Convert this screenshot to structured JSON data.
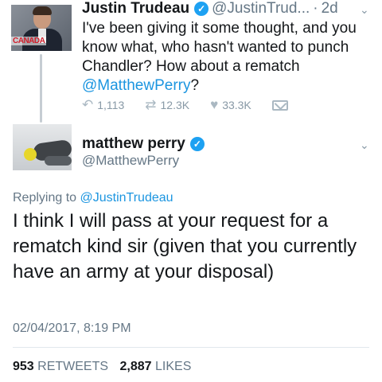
{
  "tweet1": {
    "avatar_text": "CANADA",
    "name": "Justin Trudeau",
    "handle": "@JustinTrud...",
    "separator": "·",
    "date": "2d",
    "body_text": "I've been giving it some thought, and you know what, who hasn't wanted to punch Chandler? How about a rematch ",
    "body_mention": "@MatthewPerry",
    "body_end": "?",
    "replies": "1,113",
    "retweets": "12.3K",
    "likes": "33.3K"
  },
  "tweet2": {
    "name": "matthew perry",
    "handle": "@MatthewPerry",
    "replying_prefix": "Replying to ",
    "replying_mention": "@JustinTrudeau",
    "body": "I think I will pass at your request for a rematch kind sir (given that you currently have an army at your disposal)",
    "timestamp": "02/04/2017, 8:19 PM",
    "retweet_count": "953",
    "retweet_label": "RETWEETS",
    "like_count": "2,887",
    "like_label": "LIKES"
  },
  "icons": {
    "verified": "verified-badge-icon",
    "reply": "reply-icon",
    "retweet": "retweet-icon",
    "like": "heart-icon",
    "dm": "envelope-icon",
    "caret": "chevron-down-icon"
  },
  "colors": {
    "link": "#1b95e0",
    "verified": "#1da1f2",
    "secondary": "#657786",
    "text": "#14171a"
  }
}
